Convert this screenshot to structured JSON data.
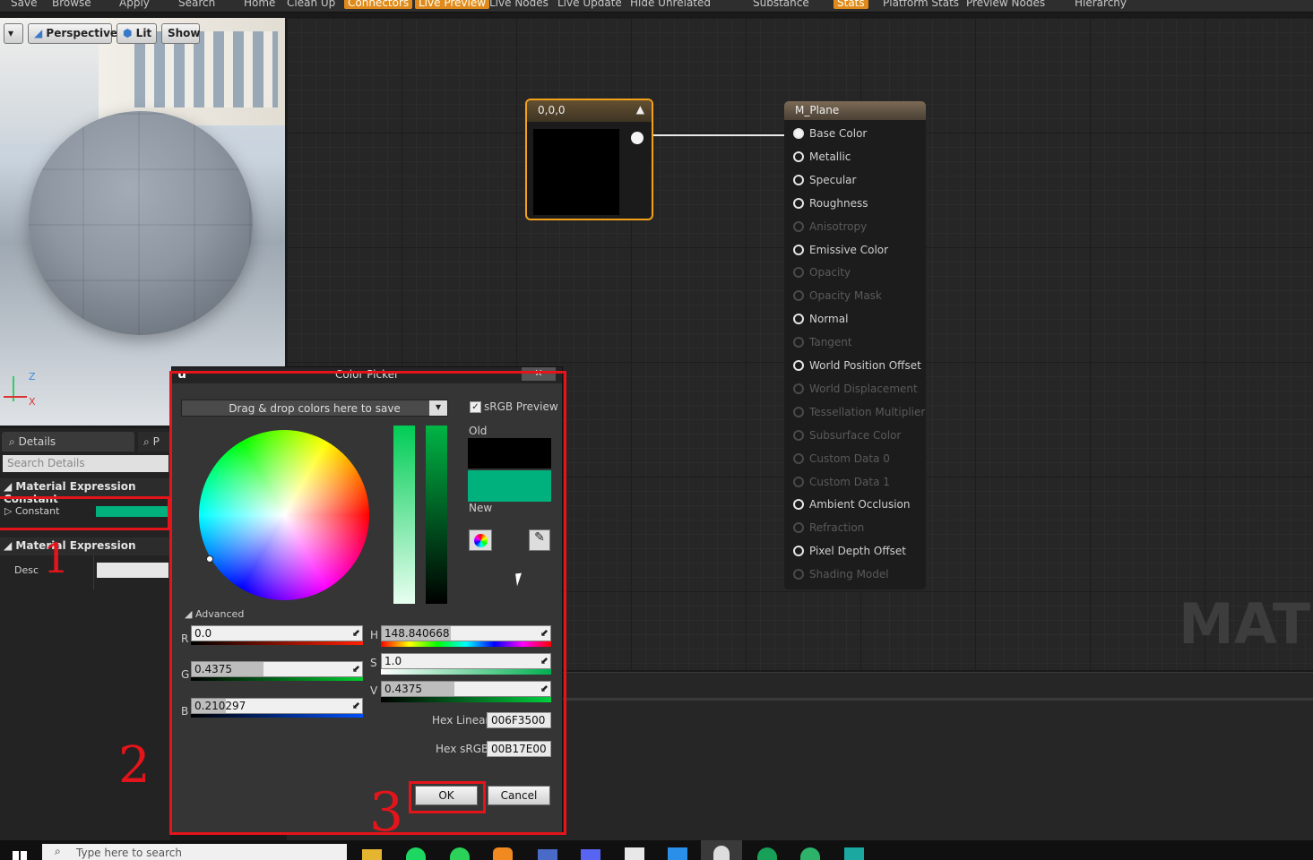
{
  "toolbar": {
    "items": [
      "Save",
      "Browse",
      "Apply",
      "Search",
      "Home",
      "Clean Up",
      "Connectors",
      "Live Preview",
      "Live Nodes",
      "Live Update",
      "Hide Unrelated",
      "Substance",
      "Stats",
      "Platform Stats",
      "Preview Nodes",
      "Hierarchy"
    ],
    "active": [
      "Connectors",
      "Live Preview",
      "Stats"
    ]
  },
  "viewport": {
    "perspective": "Perspective",
    "lit": "Lit",
    "show": "Show",
    "axis_z": "Z",
    "axis_x": "X"
  },
  "details": {
    "tab_details": "Details",
    "tab_second": "P",
    "search_placeholder": "Search Details",
    "section1": "Material Expression Constant",
    "constant_label": "Constant",
    "constant_color": "#00b17e",
    "section2": "Material Expression",
    "desc_label": "Desc"
  },
  "constant_node": {
    "title": "0,0,0",
    "swatch_color": "#000000"
  },
  "material_node": {
    "title": "M_Plane",
    "pins": [
      {
        "label": "Base Color",
        "active": true,
        "connected": true
      },
      {
        "label": "Metallic",
        "active": true
      },
      {
        "label": "Specular",
        "active": true
      },
      {
        "label": "Roughness",
        "active": true
      },
      {
        "label": "Anisotropy",
        "active": false
      },
      {
        "label": "Emissive Color",
        "active": true
      },
      {
        "label": "Opacity",
        "active": false
      },
      {
        "label": "Opacity Mask",
        "active": false
      },
      {
        "label": "Normal",
        "active": true
      },
      {
        "label": "Tangent",
        "active": false
      },
      {
        "label": "World Position Offset",
        "active": true
      },
      {
        "label": "World Displacement",
        "active": false
      },
      {
        "label": "Tessellation Multiplier",
        "active": false
      },
      {
        "label": "Subsurface Color",
        "active": false
      },
      {
        "label": "Custom Data 0",
        "active": false
      },
      {
        "label": "Custom Data 1",
        "active": false
      },
      {
        "label": "Ambient Occlusion",
        "active": true
      },
      {
        "label": "Refraction",
        "active": false
      },
      {
        "label": "Pixel Depth Offset",
        "active": true
      },
      {
        "label": "Shading Model",
        "active": false
      }
    ]
  },
  "watermark": "MATEI",
  "picker": {
    "title": "Color Picker",
    "close": "✕",
    "drag_drop": "Drag & drop colors here to save",
    "srgb_preview": "sRGB Preview",
    "old_label": "Old",
    "new_label": "New",
    "old_color": "#000000",
    "new_color": "#00b17e",
    "advanced": "Advanced",
    "r_label": "R",
    "r_value": "0.0",
    "g_label": "G",
    "g_value": "0.4375",
    "b_label": "B",
    "b_value": "0.210297",
    "h_label": "H",
    "h_value": "148.840668",
    "s_label": "S",
    "s_value": "1.0",
    "v_label": "V",
    "v_value": "0.4375",
    "hex_linear_label": "Hex Linear",
    "hex_linear": "006F3500",
    "hex_srgb_label": "Hex sRGB",
    "hex_srgb": "00B17E00",
    "ok": "OK",
    "cancel": "Cancel"
  },
  "annotations": {
    "one": "1",
    "two": "2",
    "three": "3"
  },
  "taskbar": {
    "search_placeholder": "Type here to search"
  }
}
